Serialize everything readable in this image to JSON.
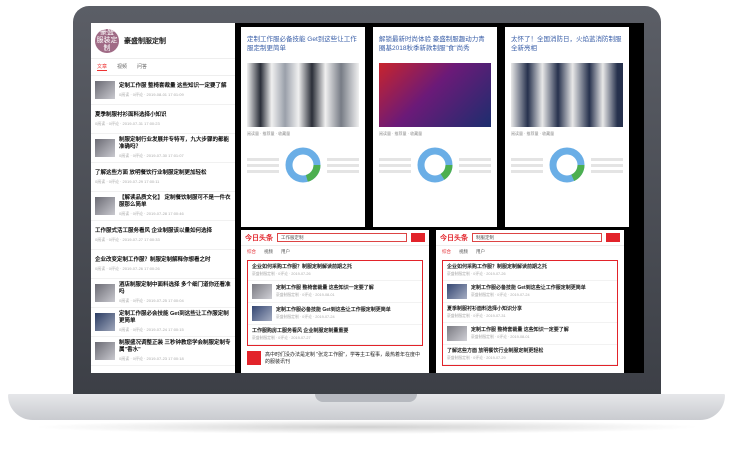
{
  "account": {
    "avatar_text": "豪盛\n服装定制",
    "name": "豪盛制服定制"
  },
  "feed": {
    "tabs": [
      "文章",
      "视频",
      "问答"
    ],
    "items": [
      {
        "title": "定制工作服 整椅套裁量 这些知识一定要了解",
        "meta": "0阅读 · 0评论 · 2019-08-01 17:01:09",
        "thumb": true
      },
      {
        "title": "夏季制服衬衫面料选择小知识",
        "meta": "0阅读 · 0评论 · 2019-07-31 17:00:23",
        "thumb": false
      },
      {
        "title": "制服定制行业发展并专特写，九大步骤的都能准确吗？",
        "meta": "0阅读 · 0评论 · 2019-07-30 17:01:07",
        "thumb": true
      },
      {
        "title": "了解这些方面 放明餐饮行业制服定制更加轻松",
        "meta": "0阅读 · 0评论 · 2019-07-29 17:00:11",
        "thumb": false
      },
      {
        "title": "【解读品质文化】 定制餐饮制服可不是一件衣服那么简单",
        "meta": "0阅读 · 0评论 · 2019-07-28 17:00:46",
        "thumb": true
      },
      {
        "title": "工作服式活工服务看风 企业制服该以量如何选择",
        "meta": "0阅读 · 0评论 · 2019-07-27 17:00:33",
        "thumb": false
      },
      {
        "title": "企业改变定制工作服？制服定制解释你想看之时",
        "meta": "0阅读 · 0评论 · 2019-07-26 17:00:26",
        "thumb": false
      },
      {
        "title": "酒店制服定制中面料选择 多个细门道你还看准吗",
        "meta": "0阅读 · 0评论 · 2019-07-25 17:00:04",
        "thumb": true
      },
      {
        "title": "定制工作服必会技能 Get到这些让工作服定制更简单",
        "meta": "0阅读 · 0评论 · 2019-07-24 17:00:15",
        "thumb": true,
        "people": true
      },
      {
        "title": "制服盛况调整正装 三秒钟教您学会制服定制专属\"香水\"",
        "meta": "0阅读 · 0评论 · 2019-07-23 17:00:18",
        "thumb": true
      }
    ]
  },
  "cards": [
    {
      "title": "定制工作服必备技能 Get到这些让工作服定制更简单",
      "photo": "uniform",
      "stats": "阅读量 · 推荐量 · 收藏量"
    },
    {
      "title": "解锁最新时尚体验 豪盛制服趣动力青圈基2018秋季新款制服\"食\"尚秀",
      "photo": "kfc",
      "stats": "阅读量 · 推荐量 · 收藏量"
    },
    {
      "title": "太怀了！全国消防日，火焰蓝消防制服全新亮相",
      "photo": "fire",
      "stats": "阅读量 · 推荐量 · 收藏量"
    }
  ],
  "colors": {
    "donut_blue": "#6aaee6",
    "donut_green": "#4caf50",
    "brand_red": "#e2232a"
  },
  "search_panels": [
    {
      "logo": "今日头条",
      "query": "工作服定制",
      "tabs": [
        "综合",
        "视频",
        "用户"
      ],
      "results": [
        {
          "title": "企业如何采购工作服？制服定制解读前期之托",
          "meta": "豪盛制服定制 · 0评论 · 2019-07-26"
        },
        {
          "title": "定制工作服 整椅套裁量 这些知识一定要了解",
          "meta": "豪盛制服定制 · 0评论 · 2019-08-01",
          "thumb": "plain"
        },
        {
          "title": "定制工作服必备技能 Get到这些让工作服定制更简单",
          "meta": "豪盛制服定制 · 0评论 · 2019-07-24",
          "thumb": "people"
        },
        {
          "title": "工作服购房工服务看风 企业制服定制量重要",
          "meta": "豪盛制服定制 · 0评论 · 2019-07-27"
        }
      ],
      "below": "高中时们没办法是定制 \"张龙工作服\"，学等主工程事，最热着年在度中的服装讯刊"
    },
    {
      "logo": "今日头条",
      "query": "制服定制",
      "tabs": [
        "综合",
        "视频",
        "用户"
      ],
      "results": [
        {
          "title": "企业如何采购工作服？制服定制解读前期之托",
          "meta": "豪盛制服定制 · 0评论 · 2019-07-26"
        },
        {
          "title": "定制工作服必备技能 Get到这些让工作服定制更简单",
          "meta": "豪盛制服定制 · 0评论 · 2019-07-24",
          "thumb": "people"
        },
        {
          "title": "夏季制服衬衫面料选择小知识分享",
          "meta": "豪盛制服定制 · 0评论 · 2019-07-31"
        },
        {
          "title": "定制工作服 整椅套裁量 这些知识一定要了解",
          "meta": "豪盛制服定制 · 0评论 · 2019-08-01",
          "thumb": "plain"
        },
        {
          "title": "了解这些方面 放明餐饮行业制服定制更轻松",
          "meta": "豪盛制服定制 · 0评论 · 2019-07-29"
        }
      ]
    }
  ]
}
